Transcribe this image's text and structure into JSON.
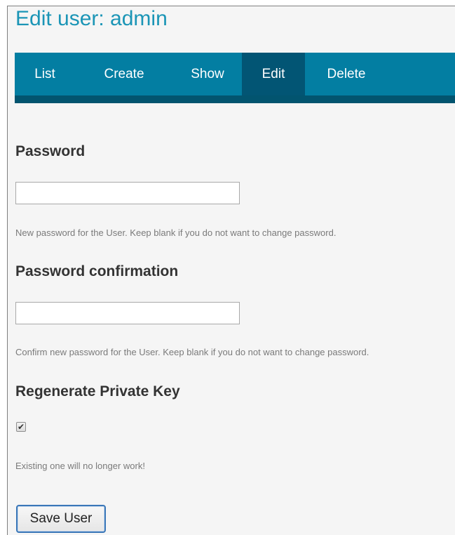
{
  "page": {
    "title": "Edit user: admin"
  },
  "nav": {
    "tabs": [
      {
        "label": "List",
        "active": false
      },
      {
        "label": "Create",
        "active": false
      },
      {
        "label": "Show",
        "active": false
      },
      {
        "label": "Edit",
        "active": true
      },
      {
        "label": "Delete",
        "active": false
      }
    ]
  },
  "form": {
    "password": {
      "label": "Password",
      "value": "",
      "help": "New password for the User. Keep blank if you do not want to change password."
    },
    "password_confirmation": {
      "label": "Password confirmation",
      "value": "",
      "help": "Confirm new password for the User. Keep blank if you do not want to change password."
    },
    "regenerate_key": {
      "label": "Regenerate Private Key",
      "checked": true,
      "help": "Existing one will no longer work!"
    },
    "save_label": "Save User"
  },
  "colors": {
    "title": "#1b95b6",
    "navbar": "#037ea2",
    "navbar_active": "#025574",
    "navbar_strip": "#02546f"
  }
}
